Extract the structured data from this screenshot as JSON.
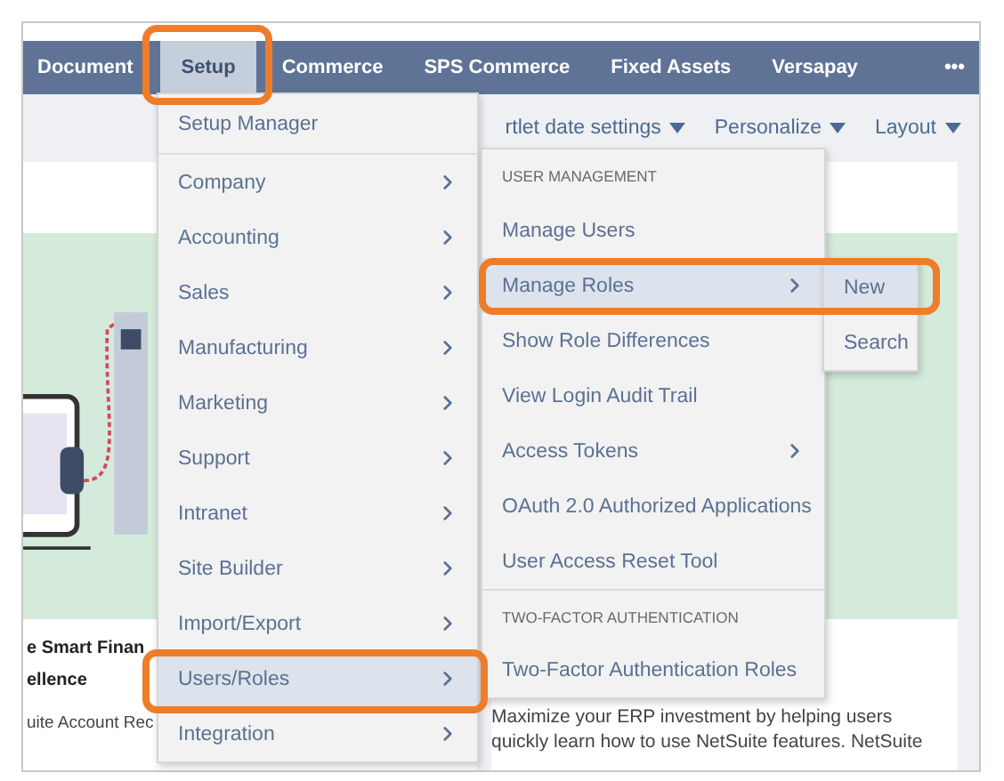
{
  "nav": {
    "items": [
      {
        "label": "Document",
        "selected": false
      },
      {
        "label": "Setup",
        "selected": true
      },
      {
        "label": "Commerce",
        "selected": false
      },
      {
        "label": "SPS Commerce",
        "selected": false
      },
      {
        "label": "Fixed Assets",
        "selected": false
      },
      {
        "label": "Versapay",
        "selected": false
      }
    ],
    "more": "•••"
  },
  "toolbar": {
    "items": [
      "rtlet date settings",
      "Personalize",
      "Layout"
    ]
  },
  "left_card": {
    "title_lines": [
      "e Smart Finan",
      "ellence"
    ],
    "text": "uite Account Rec"
  },
  "right_card": {
    "text": "Maximize your ERP investment by helping users quickly learn how to use NetSuite features. NetSuite"
  },
  "setup_menu": {
    "items": [
      {
        "label": "Setup Manager",
        "has_submenu": false,
        "selected": false
      },
      {
        "label": "Company",
        "has_submenu": true,
        "selected": false
      },
      {
        "label": "Accounting",
        "has_submenu": true,
        "selected": false
      },
      {
        "label": "Sales",
        "has_submenu": true,
        "selected": false
      },
      {
        "label": "Manufacturing",
        "has_submenu": true,
        "selected": false
      },
      {
        "label": "Marketing",
        "has_submenu": true,
        "selected": false
      },
      {
        "label": "Support",
        "has_submenu": true,
        "selected": false
      },
      {
        "label": "Intranet",
        "has_submenu": true,
        "selected": false
      },
      {
        "label": "Site Builder",
        "has_submenu": true,
        "selected": false
      },
      {
        "label": "Import/Export",
        "has_submenu": true,
        "selected": false
      },
      {
        "label": "Users/Roles",
        "has_submenu": true,
        "selected": true
      },
      {
        "label": "Integration",
        "has_submenu": true,
        "selected": false
      }
    ]
  },
  "users_roles_menu": {
    "sections": [
      {
        "heading": "USER MANAGEMENT",
        "items": [
          {
            "label": "Manage Users",
            "has_submenu": false,
            "selected": false
          },
          {
            "label": "Manage Roles",
            "has_submenu": true,
            "selected": true
          },
          {
            "label": "Show Role Differences",
            "has_submenu": false,
            "selected": false
          },
          {
            "label": "View Login Audit Trail",
            "has_submenu": false,
            "selected": false
          },
          {
            "label": "Access Tokens",
            "has_submenu": true,
            "selected": false
          },
          {
            "label": "OAuth 2.0 Authorized Applications",
            "has_submenu": false,
            "selected": false
          },
          {
            "label": "User Access Reset Tool",
            "has_submenu": false,
            "selected": false
          }
        ]
      },
      {
        "heading": "TWO-FACTOR AUTHENTICATION",
        "items": [
          {
            "label": "Two-Factor Authentication Roles",
            "has_submenu": false,
            "selected": false
          }
        ]
      }
    ]
  },
  "manage_roles_menu": {
    "items": [
      {
        "label": "New",
        "selected": true
      },
      {
        "label": "Search",
        "selected": false
      }
    ]
  }
}
